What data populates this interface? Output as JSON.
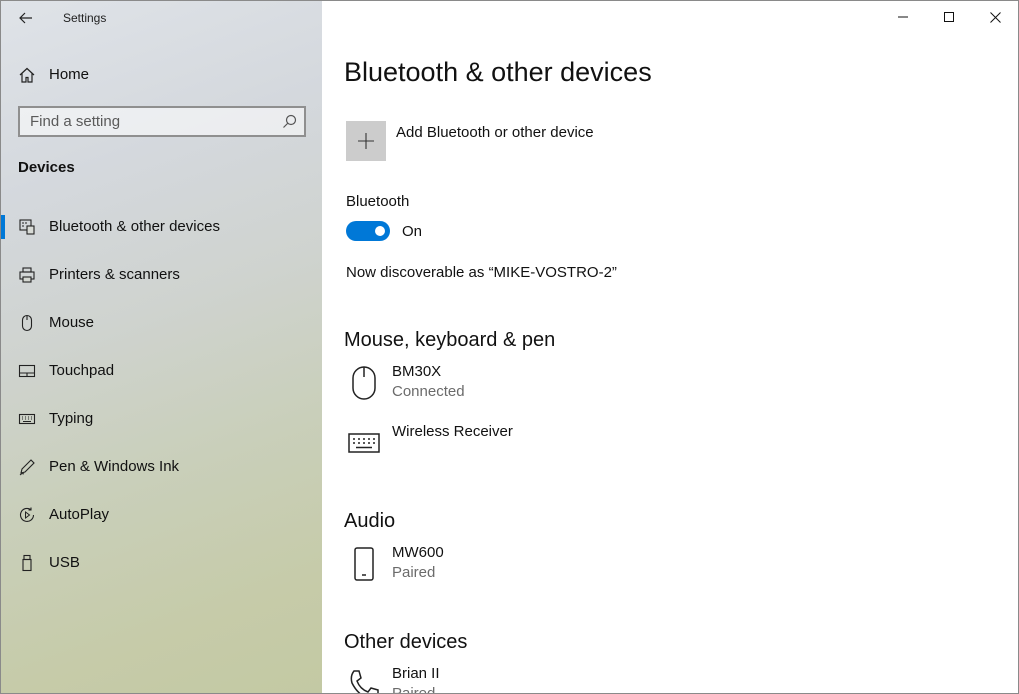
{
  "app": {
    "title": "Settings"
  },
  "sidebar": {
    "home_label": "Home",
    "search_placeholder": "Find a setting",
    "section_label": "Devices",
    "items": [
      {
        "label": "Bluetooth & other devices",
        "icon": "bluetooth-devices-icon",
        "active": true
      },
      {
        "label": "Printers & scanners",
        "icon": "printer-icon"
      },
      {
        "label": "Mouse",
        "icon": "mouse-icon"
      },
      {
        "label": "Touchpad",
        "icon": "touchpad-icon"
      },
      {
        "label": "Typing",
        "icon": "keyboard-icon"
      },
      {
        "label": "Pen & Windows Ink",
        "icon": "pen-icon"
      },
      {
        "label": "AutoPlay",
        "icon": "autoplay-icon"
      },
      {
        "label": "USB",
        "icon": "usb-icon"
      }
    ]
  },
  "main": {
    "title": "Bluetooth & other devices",
    "add_device_label": "Add Bluetooth or other device",
    "bluetooth": {
      "label": "Bluetooth",
      "state": "On",
      "discoverable_text": "Now discoverable as “MIKE-VOSTRO-2”"
    },
    "groups": [
      {
        "title": "Mouse, keyboard & pen",
        "devices": [
          {
            "name": "BM30X",
            "status": "Connected",
            "icon": "mouse-icon"
          },
          {
            "name": "Wireless Receiver",
            "status": "",
            "icon": "keyboard-icon"
          }
        ]
      },
      {
        "title": "Audio",
        "devices": [
          {
            "name": "MW600",
            "status": "Paired",
            "icon": "phone-icon"
          }
        ]
      },
      {
        "title": "Other devices",
        "devices": [
          {
            "name": "Brian II",
            "status": "Paired",
            "icon": "handset-icon"
          }
        ]
      }
    ]
  },
  "colors": {
    "accent": "#0078d7",
    "add_box": "#cccccc",
    "secondary_text": "#6b6b6b"
  }
}
